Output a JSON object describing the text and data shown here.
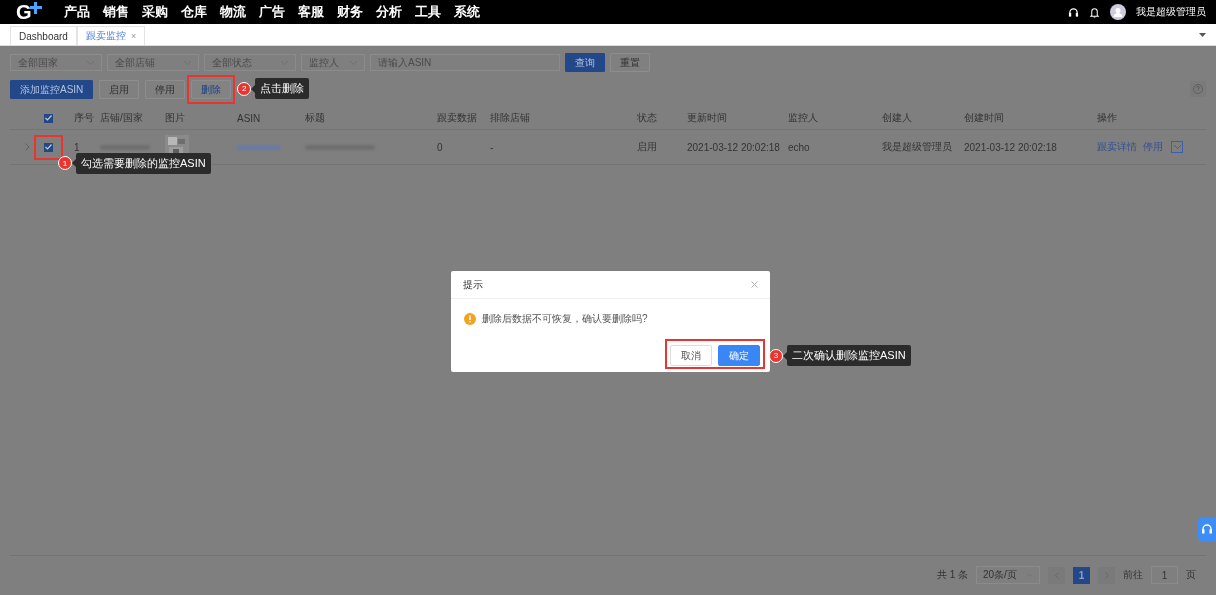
{
  "nav": {
    "logo": "G",
    "menu": [
      "产品",
      "销售",
      "采购",
      "仓库",
      "物流",
      "广告",
      "客服",
      "财务",
      "分析",
      "工具",
      "系统"
    ],
    "user": "我是超级管理员"
  },
  "tabs": [
    {
      "label": "Dashboard",
      "selected": false,
      "closable": false
    },
    {
      "label": "跟卖监控",
      "selected": true,
      "closable": true,
      "close": "×"
    }
  ],
  "filters": [
    {
      "kind": "select",
      "placeholder": "全部国家"
    },
    {
      "kind": "select",
      "placeholder": "全部店铺"
    },
    {
      "kind": "select",
      "placeholder": "全部状态"
    },
    {
      "kind": "select",
      "placeholder": "监控人"
    },
    {
      "kind": "input",
      "placeholder": "请输入ASIN"
    }
  ],
  "filter_buttons": [
    {
      "label": "查询",
      "kind": "primary"
    },
    {
      "label": "重置",
      "kind": "default"
    }
  ],
  "actions": [
    {
      "label": "添加监控ASIN",
      "kind": "primary"
    },
    {
      "label": "启用",
      "kind": "default"
    },
    {
      "label": "停用",
      "kind": "default"
    },
    {
      "label": "删除",
      "kind": "text",
      "annotation": {
        "number": "2",
        "text": "点击删除"
      }
    }
  ],
  "table": {
    "all_checked": true,
    "columns": [
      "序号",
      "店铺/国家",
      "图片",
      "ASIN",
      "标题",
      "跟卖数据",
      "排除店铺",
      "状态",
      "更新时间",
      "监控人",
      "创建人",
      "创建时间",
      "操作"
    ],
    "rows": [
      {
        "expanded": false,
        "checked": true,
        "annotation": {
          "number": "1",
          "text": "勾选需要删除的监控ASIN"
        },
        "index": "1",
        "follow_data": "0",
        "excluded": "-",
        "status": "启用",
        "updated": "2021-03-12 20:02:18",
        "monitor": "echo",
        "creator": "我是超级管理员",
        "created": "2021-03-12 20:02:18",
        "links": [
          "跟卖详情",
          "停用"
        ]
      }
    ]
  },
  "pagination": {
    "total": "共 1 条",
    "page_size": "20条/页",
    "pages": [
      {
        "label": "1",
        "selected": true
      }
    ],
    "goto_label": "前往",
    "goto_value": "1",
    "goto_unit": "页"
  },
  "dialog": {
    "title": "提示",
    "message": "删除后数据不可恢复，确认要删除吗?",
    "buttons": [
      {
        "label": "取消",
        "kind": "default"
      },
      {
        "label": "确定",
        "kind": "primary"
      }
    ],
    "annotation": {
      "number": "3",
      "text": "二次确认删除监控ASIN"
    }
  }
}
